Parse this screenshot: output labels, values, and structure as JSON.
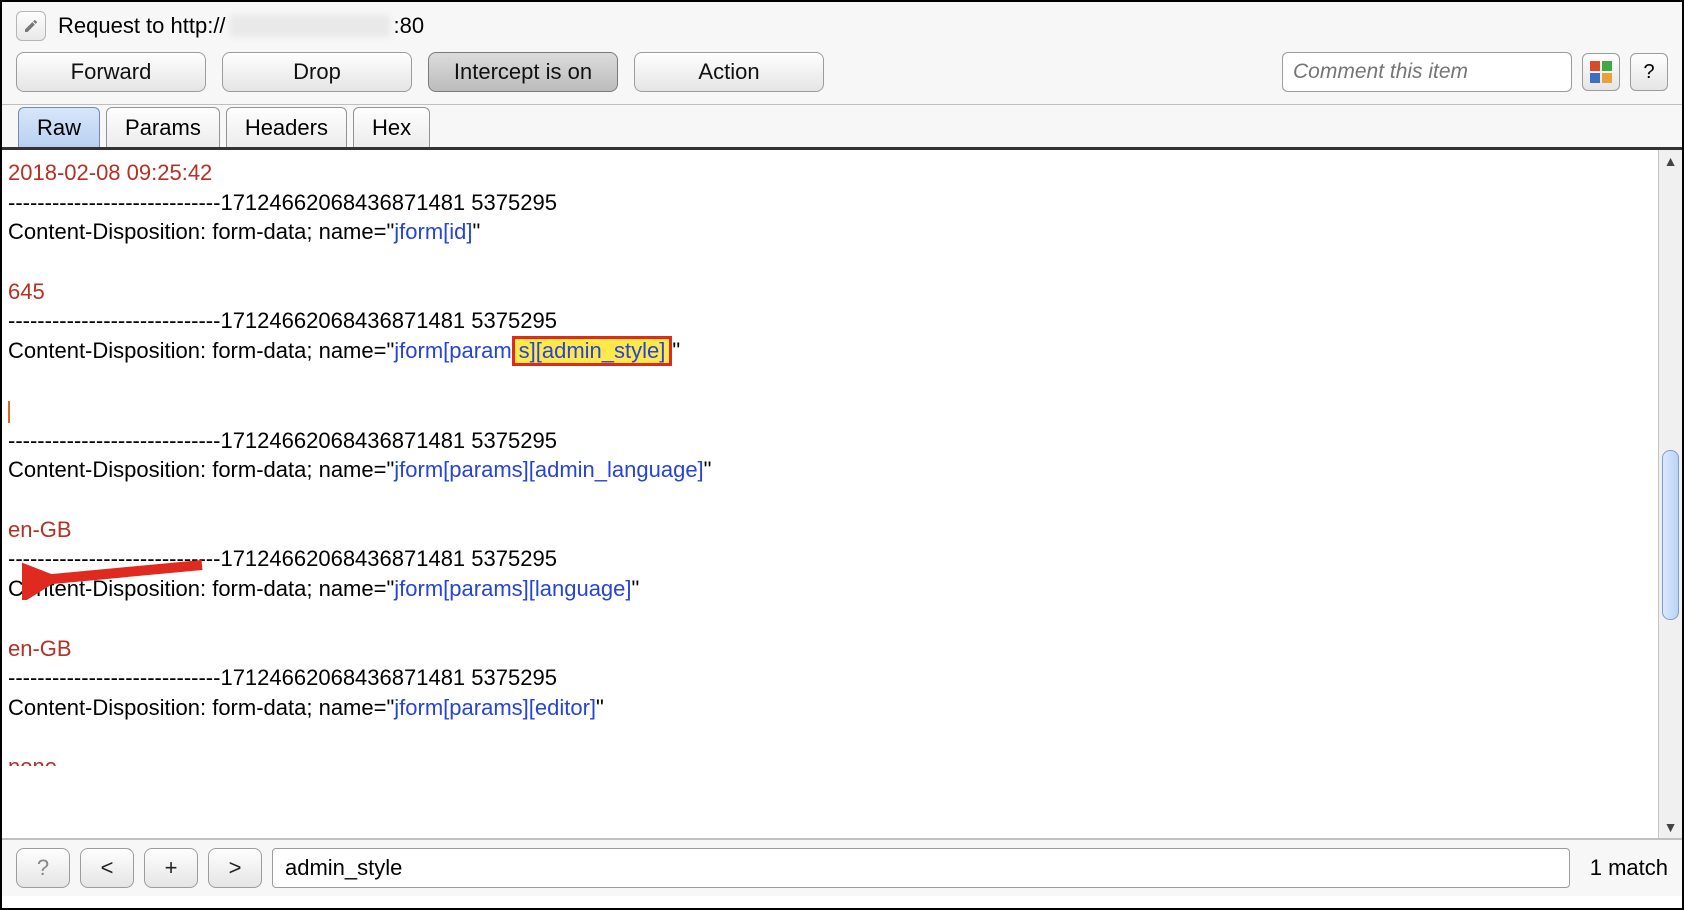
{
  "title": {
    "prefix": "Request to http://",
    "suffix": ":80"
  },
  "toolbar": {
    "forward": "Forward",
    "drop": "Drop",
    "intercept": "Intercept is on",
    "action": "Action",
    "comment_placeholder": "Comment this item",
    "help_label": "?"
  },
  "tabs": {
    "raw": "Raw",
    "params": "Params",
    "headers": "Headers",
    "hex": "Hex"
  },
  "payload": {
    "timestamp": "2018-02-08 09:25:42",
    "boundary": "-----------------------------17124662068436871481 5375295",
    "cd_prefix": "Content-Disposition: form-data; name=\"",
    "cd_suffix": "\"",
    "fields": {
      "id": {
        "name": "jform[id]",
        "value": "645"
      },
      "admin_style": {
        "name_a": "jform[param",
        "name_hl": "s][admin_style]",
        "value": ""
      },
      "admin_language": {
        "name": "jform[params][admin_language]",
        "value": "en-GB"
      },
      "language": {
        "name": "jform[params][language]",
        "value": "en-GB"
      },
      "editor": {
        "name": "jform[params][editor]",
        "value_cut": "none"
      }
    }
  },
  "search": {
    "help": "?",
    "prev": "<",
    "add": "+",
    "next": ">",
    "value": "admin_style",
    "matches": "1 match"
  }
}
